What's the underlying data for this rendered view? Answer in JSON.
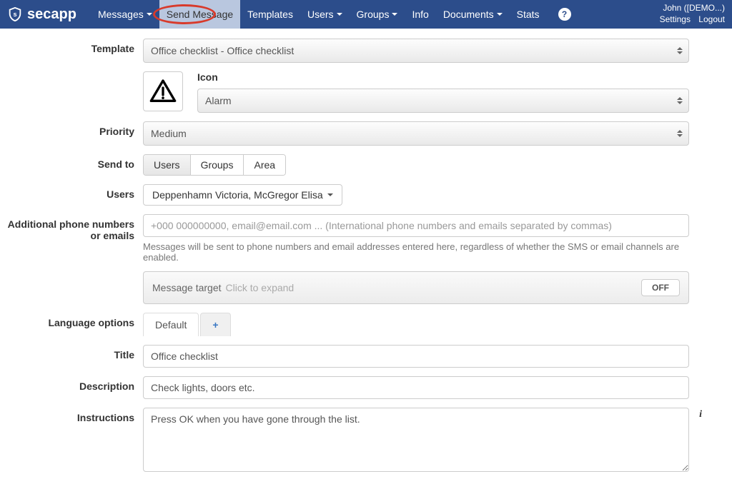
{
  "brand": "secapp",
  "nav": {
    "messages": "Messages",
    "send_message": "Send Message",
    "templates": "Templates",
    "users": "Users",
    "groups": "Groups",
    "info": "Info",
    "documents": "Documents",
    "stats": "Stats"
  },
  "user": {
    "name": "John  ([DEMO...)",
    "settings": "Settings",
    "logout": "Logout"
  },
  "labels": {
    "template": "Template",
    "icon": "Icon",
    "priority": "Priority",
    "send_to": "Send to",
    "users": "Users",
    "additional": "Additional phone numbers or emails",
    "language_options": "Language options",
    "title": "Title",
    "description": "Description",
    "instructions": "Instructions"
  },
  "template_select": "Office checklist - Office checklist",
  "icon_select": "Alarm",
  "priority_select": "Medium",
  "send_to": {
    "users": "Users",
    "groups": "Groups",
    "area": "Area"
  },
  "users_selected": "Deppenhamn Victoria, McGregor Elisa",
  "additional_placeholder": "+000 000000000, email@email.com ... (International phone numbers and emails separated by commas)",
  "additional_help": "Messages will be sent to phone numbers and email addresses entered here, regardless of whether the SMS or email channels are enabled.",
  "message_target": {
    "label": "Message target",
    "hint": "Click to expand",
    "toggle": "OFF"
  },
  "lang_tabs": {
    "default": "Default",
    "add": "+"
  },
  "title_value": "Office checklist",
  "description_value": "Check lights, doors etc.",
  "instructions_value": "Press OK when you have gone through the list."
}
